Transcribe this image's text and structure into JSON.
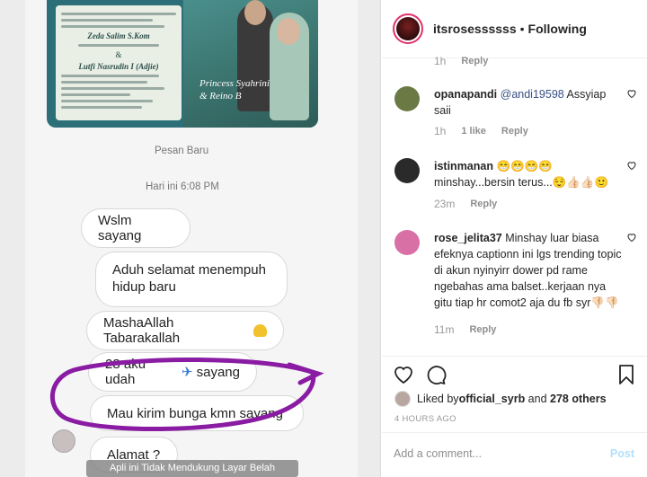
{
  "post_image": {
    "invitation": {
      "names": [
        "Zeda Salim S.Kom",
        "&",
        "Lutfi Nasrudin I (Adjie)"
      ],
      "caption_lines": [
        "Princess Syahrini",
        "& Reino B"
      ]
    },
    "chat": {
      "header": "Pesan Baru",
      "timestamp": "Hari ini 6:08 PM",
      "messages": [
        "Wslm sayang",
        "Aduh selamat menempuh hidup baru",
        "MashaAllah Tabarakallah",
        "28 aku udah",
        "sayang",
        "Mau kirim bunga kmn sayang",
        "Alamat ?"
      ],
      "banner": "Apli ini Tidak Mendukung Layar Belah"
    }
  },
  "header": {
    "username": "itsrosessssss",
    "separator": "•",
    "follow_status": "Following"
  },
  "comments": {
    "top_meta": {
      "time": "1h",
      "reply": "Reply"
    },
    "items": [
      {
        "username": "opanapandi",
        "mention": "@andi19598",
        "text": " Assyiap saii",
        "time": "1h",
        "likes": "1 like",
        "reply": "Reply",
        "avatar_color": "#6b7a45"
      },
      {
        "username": "istinmanan",
        "text": " 😁😁😁😁 minshay...bersin terus...😌👍🏻👍🏻🙂",
        "time": "23m",
        "reply": "Reply",
        "avatar_color": "#2a2a2a"
      },
      {
        "username": "rose_jelita37",
        "text": " Minshay luar biasa efeknya captionn ini lgs trending topic di akun nyinyirr dower pd rame ngebahas ama balset..kerjaan nya gitu tiap hr comot2 aja du fb syr👎🏻👎🏻",
        "time": "11m",
        "reply": "Reply",
        "avatar_color": "#d86fa5"
      }
    ]
  },
  "actions": {
    "liked_by_prefix": "Liked by ",
    "liked_by_user": "official_syrb",
    "liked_by_and": " and ",
    "likes_other": "278 others",
    "posted_ago": "4 HOURS AGO"
  },
  "add_comment": {
    "placeholder": "Add a comment...",
    "post_label": "Post"
  },
  "colors": {
    "accent_link": "#385185",
    "post_disabled": "#b2dffc",
    "story_ring": "#e1306c"
  }
}
